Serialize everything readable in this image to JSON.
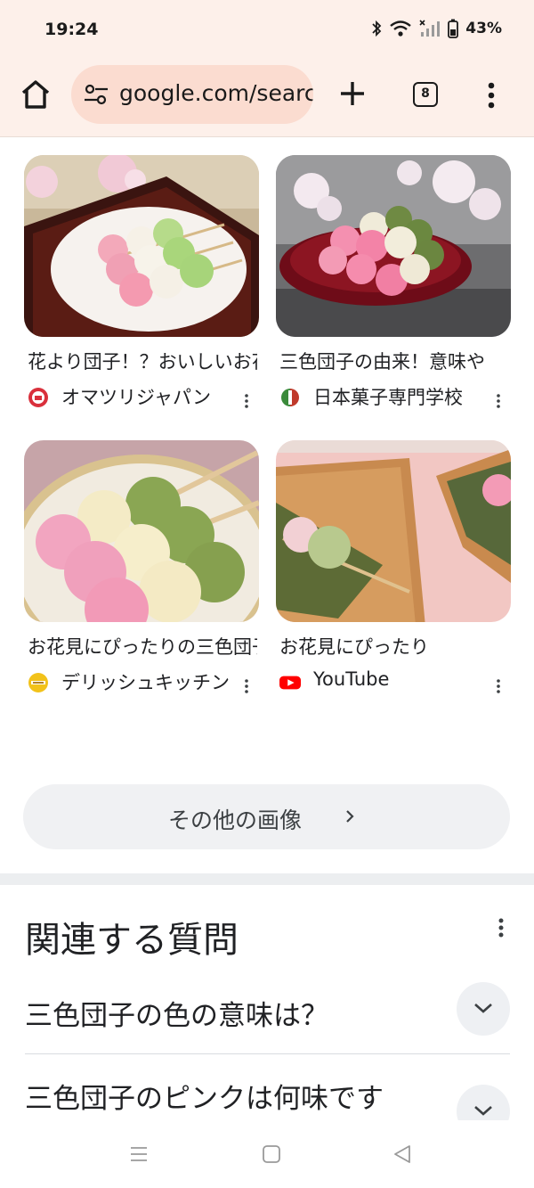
{
  "status": {
    "time": "19:24",
    "battery": "43%",
    "icons": [
      "bluetooth-icon",
      "wifi-icon",
      "signal-icon",
      "battery-icon"
    ]
  },
  "toolbar": {
    "url": "google.com/search",
    "tab_count": "8",
    "icons": [
      "home-icon",
      "site-settings-icon",
      "new-tab-icon",
      "tab-switcher-icon",
      "overflow-menu-icon"
    ]
  },
  "images": [
    {
      "title": "花より団子！？おいしいお花見",
      "source": "オマツリジャパン",
      "source_icon": "matsuri-logo-icon",
      "source_color": "#d9303c"
    },
    {
      "title": "三色団子の由来！意味や",
      "source": "日本菓子専門学校",
      "source_icon": "school-logo-icon",
      "source_color": "#3a8a3a"
    },
    {
      "title": "お花見にぴったりの三色団子",
      "source": "デリッシュキッチン",
      "source_icon": "delish-kitchen-icon",
      "source_color": "#f2c21a"
    },
    {
      "title": "お花見にぴったり",
      "source": "YouTube",
      "source_icon": "youtube-icon",
      "source_color": "#ff0000"
    }
  ],
  "more_images": {
    "label": "その他の画像"
  },
  "related": {
    "title": "関連する質問",
    "questions": [
      {
        "text": "三色団子の色の意味は？"
      },
      {
        "text": "三色団子のピンクは何味です"
      }
    ]
  },
  "navbar": {
    "icons": [
      "recents-icon",
      "home-nav-icon",
      "back-icon"
    ]
  },
  "colors": {
    "toolbar_bg": "#fdf0ea",
    "url_pill": "#fbdcd0",
    "chip_bg": "#f0f1f3"
  }
}
